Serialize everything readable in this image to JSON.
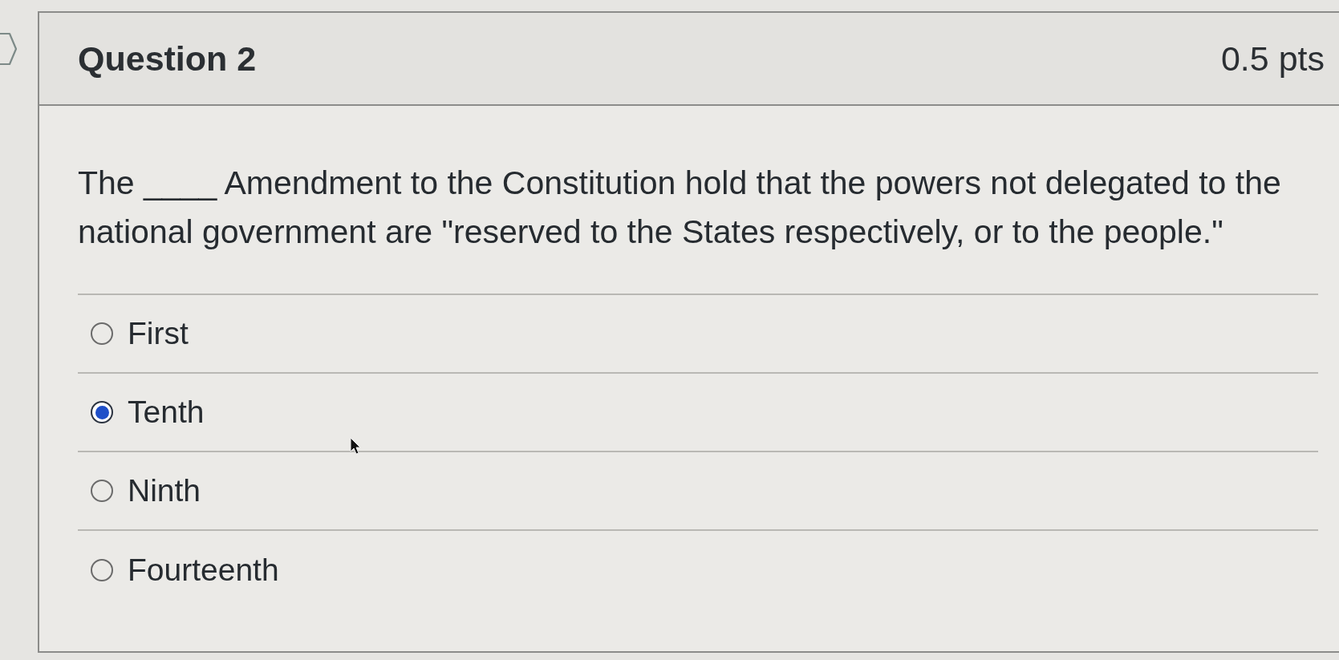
{
  "question": {
    "title": "Question 2",
    "points": "0.5 pts",
    "text": "The ____ Amendment to the Constitution hold that the powers not delegated to the national government are \"reserved to the States respectively, or to the people.\""
  },
  "answers": [
    {
      "label": "First",
      "selected": false
    },
    {
      "label": "Tenth",
      "selected": true
    },
    {
      "label": "Ninth",
      "selected": false
    },
    {
      "label": "Fourteenth",
      "selected": false
    }
  ]
}
